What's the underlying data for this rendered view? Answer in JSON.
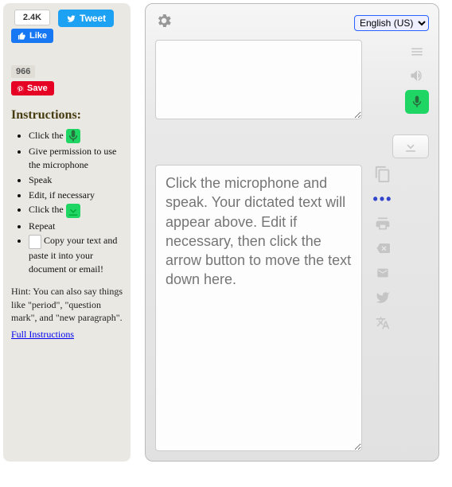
{
  "social": {
    "like_count": "2.4K",
    "like_label": "Like",
    "tweet_label": "Tweet",
    "pin_count": "966",
    "pin_label": "Save"
  },
  "instructions": {
    "heading": "Instructions:",
    "items": [
      "Click the ",
      "Give permission to use the microphone",
      "Speak",
      "Edit, if necessary",
      "Click the ",
      "Repeat",
      " Copy your text and paste it into your document or email!"
    ],
    "hint": "Hint: You can also say things like \"period\", \"question mark\", and \"new paragraph\".",
    "full_link": "Full Instructions"
  },
  "main": {
    "language_options": [
      "English (US)"
    ],
    "language_selected": "English (US)",
    "upper_text": "",
    "lower_placeholder": "Click the microphone and speak. Your dictated text will appear above. Edit if necessary, then click the arrow button to move the text down here."
  }
}
